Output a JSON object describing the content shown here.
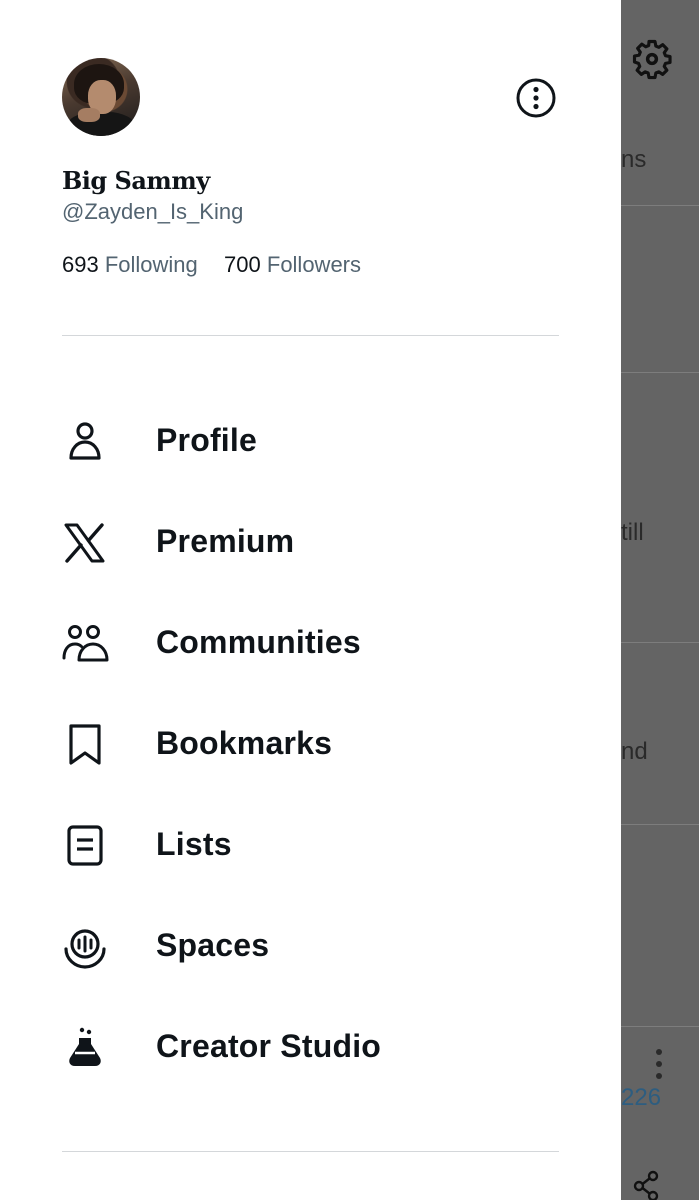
{
  "background": {
    "snippets": [
      "ns",
      "till",
      "nd",
      "226"
    ]
  },
  "drawer": {
    "display_name": "Big Sammy",
    "handle": "@Zayden_Is_King",
    "following_count": "693",
    "following_label": "Following",
    "followers_count": "700",
    "followers_label": "Followers",
    "menu": [
      {
        "label": "Profile",
        "icon": "person-icon"
      },
      {
        "label": "Premium",
        "icon": "x-logo-icon"
      },
      {
        "label": "Communities",
        "icon": "communities-icon"
      },
      {
        "label": "Bookmarks",
        "icon": "bookmark-icon"
      },
      {
        "label": "Lists",
        "icon": "lists-icon"
      },
      {
        "label": "Spaces",
        "icon": "spaces-icon"
      },
      {
        "label": "Creator Studio",
        "icon": "flask-icon"
      }
    ]
  },
  "colors": {
    "text_primary": "#0f1419",
    "text_secondary": "#536471",
    "overlay": "#646464"
  }
}
